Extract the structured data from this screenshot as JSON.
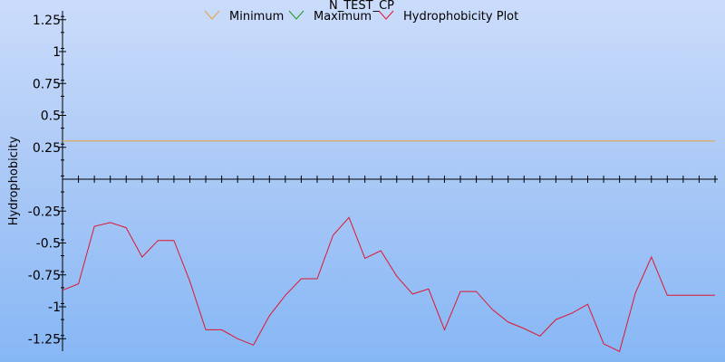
{
  "chart_data": {
    "type": "line",
    "title": "N_TEST_CP",
    "xlabel": "",
    "ylabel": "Hydrophobicity",
    "ylim": [
      -1.37,
      1.3
    ],
    "yticks": [
      1.25,
      1,
      0.75,
      0.5,
      0.25,
      -0.25,
      -0.5,
      -0.75,
      -1,
      -1.25
    ],
    "ytick_labels": [
      "1.25",
      "1",
      "0.75",
      "0.5",
      "0.25",
      "-0.25",
      "-0.5",
      "-0.75",
      "-1",
      "-1.25"
    ],
    "x": [
      1,
      2,
      3,
      4,
      5,
      6,
      7,
      8,
      9,
      10,
      11,
      12,
      13,
      14,
      15,
      16,
      17,
      18,
      19,
      20,
      21,
      22,
      23,
      24,
      25,
      26,
      27,
      28,
      29,
      30,
      31,
      32,
      33,
      34,
      35,
      36,
      37,
      38,
      39,
      40,
      41,
      42
    ],
    "xlim": [
      1,
      42
    ],
    "legend_position": "top-center",
    "grid": false,
    "series": [
      {
        "name": "Minimum",
        "color": "#e6a23c",
        "values": [
          0.3,
          0.3,
          0.3,
          0.3,
          0.3,
          0.3,
          0.3,
          0.3,
          0.3,
          0.3,
          0.3,
          0.3,
          0.3,
          0.3,
          0.3,
          0.3,
          0.3,
          0.3,
          0.3,
          0.3,
          0.3,
          0.3,
          0.3,
          0.3,
          0.3,
          0.3,
          0.3,
          0.3,
          0.3,
          0.3,
          0.3,
          0.3,
          0.3,
          0.3,
          0.3,
          0.3,
          0.3,
          0.3,
          0.3,
          0.3,
          0.3,
          0.3
        ]
      },
      {
        "name": "Maximum",
        "color": "#1a9a1a",
        "values": []
      },
      {
        "name": "Hydrophobicity Plot",
        "color": "#e0152f",
        "values": [
          -0.87,
          -0.82,
          -0.37,
          -0.34,
          -0.38,
          -0.61,
          -0.48,
          -0.48,
          -0.8,
          -1.18,
          -1.18,
          -1.25,
          -1.3,
          -1.07,
          -0.91,
          -0.78,
          -0.78,
          -0.44,
          -0.3,
          -0.62,
          -0.56,
          -0.76,
          -0.9,
          -0.86,
          -1.18,
          -0.88,
          -0.88,
          -1.02,
          -1.12,
          -1.17,
          -1.23,
          -1.1,
          -1.05,
          -0.98,
          -1.29,
          -1.35,
          -0.89,
          -0.61,
          -0.91,
          -0.91,
          -0.91,
          -0.91
        ]
      }
    ]
  }
}
